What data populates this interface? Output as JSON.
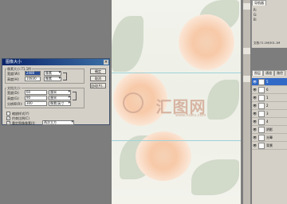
{
  "dialog": {
    "title": "图像大小",
    "close_glyph": "×",
    "pixel_dims_label": "像素大小:71.1M",
    "width_label": "宽度(W):",
    "width_value": "2480",
    "width_unit": "像素",
    "height_label": "高度(H):",
    "height_value": "10830",
    "height_unit": "像素",
    "doc_size_label": "文档大小:",
    "doc_width_label": "宽度(D):",
    "doc_width_value": "60",
    "doc_width_unit": "厘米",
    "doc_height_label": "高度(G):",
    "doc_height_value": "90",
    "doc_height_unit": "厘米",
    "resolution_label": "分辨率(R):",
    "resolution_value": "300",
    "resolution_unit": "像素/英寸",
    "scale_styles_label": "缩放样式(Y)",
    "constrain_label": "约束比例(C)",
    "resample_label": "重定图像像素(I):",
    "resample_value": "两次立方",
    "ok_button": "确定",
    "cancel_button": "取消",
    "auto_button": "自动(A)..."
  },
  "canvas": {
    "watermark_text": "汇图网",
    "watermark_sub": "www.huitu.com"
  },
  "navigator": {
    "tabs": [
      "导航器",
      "信息",
      "直方图"
    ],
    "readout_a": "R:",
    "readout_b": "G:",
    "readout_c": "B:",
    "doc_info": "文档:71.1M/301.1M"
  },
  "layers": {
    "tabs": [
      "图层",
      "通道",
      "路径"
    ],
    "items": [
      {
        "name": "5",
        "active": true
      },
      {
        "name": "6",
        "active": false
      },
      {
        "name": "1",
        "active": false
      },
      {
        "name": "2",
        "active": false
      },
      {
        "name": "3",
        "active": false
      },
      {
        "name": "4",
        "active": false
      },
      {
        "name": "阴影",
        "active": false
      },
      {
        "name": "光晕",
        "active": false
      },
      {
        "name": "背景",
        "active": false
      }
    ]
  },
  "colors": {
    "titlebar": "#0a246a",
    "selection": "#3169c6",
    "panel_bg": "#d4d0c8"
  }
}
